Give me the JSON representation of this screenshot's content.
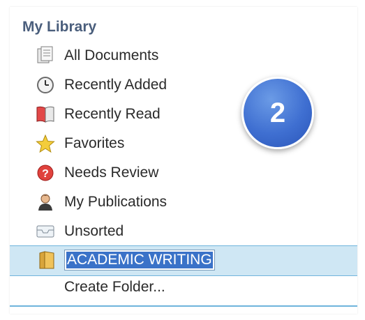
{
  "library": {
    "title": "My Library",
    "items": [
      {
        "label": "All Documents",
        "icon": "documents-icon"
      },
      {
        "label": "Recently Added",
        "icon": "clock-icon"
      },
      {
        "label": "Recently Read",
        "icon": "book-icon"
      },
      {
        "label": "Favorites",
        "icon": "star-icon"
      },
      {
        "label": "Needs Review",
        "icon": "question-icon"
      },
      {
        "label": "My Publications",
        "icon": "person-icon"
      },
      {
        "label": "Unsorted",
        "icon": "inbox-icon"
      }
    ],
    "folder": {
      "name": "ACADEMIC WRITING",
      "icon": "folder-icon"
    },
    "create_folder": "Create Folder..."
  },
  "badge": {
    "number": "2"
  },
  "colors": {
    "title": "#4a5e7c",
    "selection_bg": "#cfe7f4",
    "selection_border": "#6fb4dc",
    "text_highlight": "#3a72c8",
    "badge": "#3f6fd1"
  }
}
